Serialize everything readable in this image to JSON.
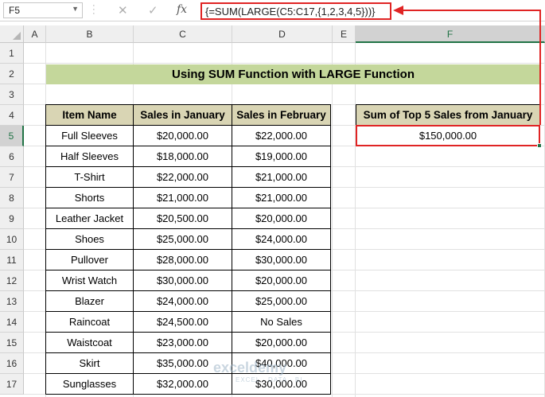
{
  "formula_bar": {
    "name_box": "F5",
    "cancel_icon": "close-icon",
    "enter_icon": "check-icon",
    "fx_label": "fx",
    "formula": "{=SUM(LARGE(C5:C17,{1,2,3,4,5}))}"
  },
  "columns": [
    "A",
    "B",
    "C",
    "D",
    "E",
    "F"
  ],
  "rows": [
    "1",
    "2",
    "3",
    "4",
    "5",
    "6",
    "7",
    "8",
    "9",
    "10",
    "11",
    "12",
    "13",
    "14",
    "15",
    "16",
    "17"
  ],
  "sheet": {
    "title": "Using SUM Function with LARGE Function",
    "headers": [
      "Item Name",
      "Sales in January",
      "Sales in February"
    ],
    "items": [
      [
        "Full Sleeves",
        "$20,000.00",
        "$22,000.00"
      ],
      [
        "Half Sleeves",
        "$18,000.00",
        "$19,000.00"
      ],
      [
        "T-Shirt",
        "$22,000.00",
        "$21,000.00"
      ],
      [
        "Shorts",
        "$21,000.00",
        "$21,000.00"
      ],
      [
        "Leather Jacket",
        "$20,500.00",
        "$20,000.00"
      ],
      [
        "Shoes",
        "$25,000.00",
        "$24,000.00"
      ],
      [
        "Pullover",
        "$28,000.00",
        "$30,000.00"
      ],
      [
        "Wrist Watch",
        "$30,000.00",
        "$20,000.00"
      ],
      [
        "Blazer",
        "$24,000.00",
        "$25,000.00"
      ],
      [
        "Raincoat",
        "$24,500.00",
        "No Sales"
      ],
      [
        "Waistcoat",
        "$23,000.00",
        "$20,000.00"
      ],
      [
        "Skirt",
        "$35,000.00",
        "$40,000.00"
      ],
      [
        "Sunglasses",
        "$32,000.00",
        "$30,000.00"
      ]
    ],
    "sum_header": "Sum of Top 5 Sales from January",
    "sum_value": "$150,000.00"
  },
  "watermark": {
    "name": "exceldemy",
    "tagline": "EXCEL · DATA · BI"
  },
  "colors": {
    "title_bg": "#c4d79b",
    "header_bg": "#d9d5b4",
    "highlight": "#e02424",
    "excel_green": "#217346"
  }
}
